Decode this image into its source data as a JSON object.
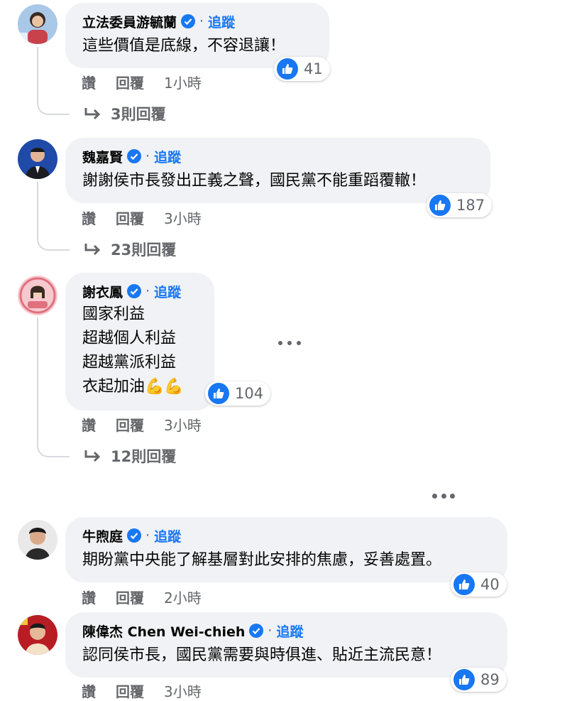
{
  "comments": [
    {
      "name": "立法委員游毓蘭",
      "dot": "·",
      "follow": "追蹤",
      "text": [
        "這些價值是底線，不容退讓！"
      ],
      "likes": "41",
      "like": "讚",
      "reply": "回覆",
      "time": "1小時",
      "replies": "3則回覆"
    },
    {
      "name": "魏嘉賢",
      "dot": "·",
      "follow": "追蹤",
      "text": [
        "謝謝侯市長發出正義之聲，國民黨不能重蹈覆轍！"
      ],
      "likes": "187",
      "like": "讚",
      "reply": "回覆",
      "time": "3小時",
      "replies": "23則回覆"
    },
    {
      "name": "謝衣鳳",
      "dot": "·",
      "follow": "追蹤",
      "text": [
        "國家利益",
        "超越個人利益",
        "超越黨派利益",
        "衣起加油💪💪"
      ],
      "likes": "104",
      "like": "讚",
      "reply": "回覆",
      "time": "3小時",
      "replies": "12則回覆"
    },
    {
      "name": "牛煦庭",
      "dot": "·",
      "follow": "追蹤",
      "text": [
        "期盼黨中央能了解基層對此安排的焦慮，妥善處置。"
      ],
      "likes": "40",
      "like": "讚",
      "reply": "回覆",
      "time": "2小時"
    },
    {
      "name": "陳偉杰 Chen Wei-chieh",
      "dot": "·",
      "follow": "追蹤",
      "text": [
        "認同侯市長，國民黨需要與時俱進、貼近主流民意！"
      ],
      "likes": "89",
      "like": "讚",
      "reply": "回覆",
      "time": "3小時"
    }
  ],
  "colors": {
    "accent": "#1877f2",
    "bubble": "#f0f2f5",
    "muted": "#65676b"
  }
}
